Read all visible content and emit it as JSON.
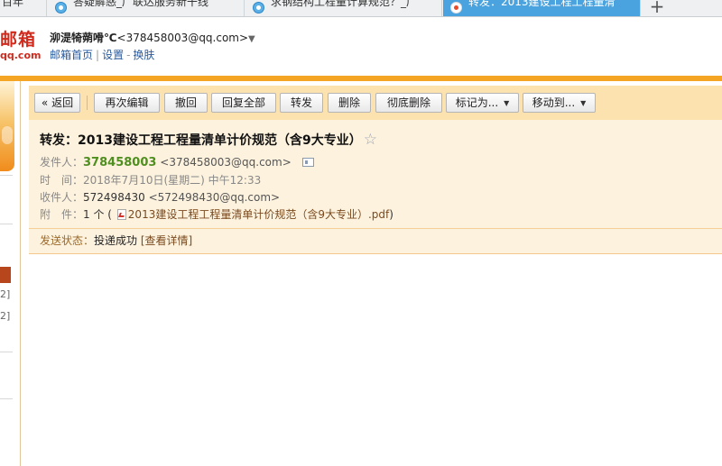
{
  "browser": {
    "tabs": [
      {
        "label": "百年"
      },
      {
        "label": "答疑解惑_广联达服务新干线"
      },
      {
        "label": "求钢结构工程量计算规范？_广"
      },
      {
        "label": "转发：2013建设工程工程量清"
      }
    ],
    "new_tab": "+"
  },
  "header": {
    "logo_main": "邮箱",
    "logo_sub": "qq.com",
    "user_nick": "泖湜犄蒴嗗℃",
    "user_email": "<378458003@qq.com>",
    "user_caret": "▼",
    "links": [
      "邮箱首页",
      "设置",
      "换肤"
    ],
    "sep1": "|",
    "sep2": "-"
  },
  "nav": {
    "count1": "2]",
    "count2": "2]"
  },
  "toolbar": {
    "back": "« 返回",
    "edit_again": "再次编辑",
    "recall": "撤回",
    "reply_all": "回复全部",
    "forward": "转发",
    "delete": "删除",
    "delete_permanently": "彻底删除",
    "mark_as": "标记为...",
    "move_to": "移动到...",
    "caret": "▼"
  },
  "message": {
    "subject": "转发：2013建设工程工程量清单计价规范（含9大专业）",
    "star": "☆",
    "from_label": "发件人：",
    "from_name": "378458003",
    "from_email": "<378458003@qq.com>",
    "time_label": "时　间：",
    "time_value": "2018年7月10日(星期二) 中午12:33",
    "to_label": "收件人：",
    "to_name": "572498430",
    "to_email": "<572498430@qq.com>",
    "attach_label": "附　件：",
    "attach_count": "1 个 (",
    "attach_name": "2013建设工程工程量清单计价规范（含9大专业）.pdf",
    "attach_close": ")",
    "status_label": "发送状态：",
    "status_value": "投递成功",
    "status_link": "[查看详情]"
  }
}
